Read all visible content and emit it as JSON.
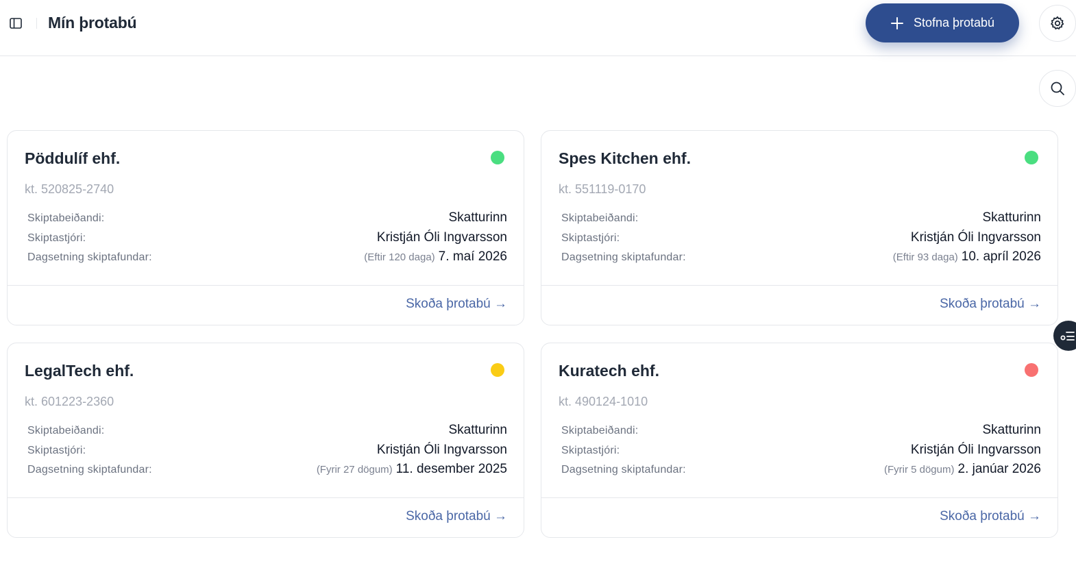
{
  "header": {
    "title": "Mín þrotabú",
    "create_label": "Stofna þrotabú"
  },
  "colors": {
    "accent": "#2e4d8f",
    "status_green": "#4ade80",
    "status_yellow": "#facc15",
    "status_red": "#f87171"
  },
  "icons": {
    "sidebar": "sidebar-toggle-icon",
    "create": "plus-icon",
    "settings": "gear-icon",
    "search": "search-icon",
    "side_panel": "list-settings-icon"
  },
  "labels": {
    "requester": "Skiptabeiðandi:",
    "administrator": "Skiptastjóri:",
    "meeting_date": "Dagsetning skiptafundar:",
    "view_link": "Skoða þrotabú →"
  },
  "estates": [
    {
      "name": "Pöddulíf ehf.",
      "kt": "kt. 520825-2740",
      "status": "green",
      "requester": "Skatturinn",
      "administrator": "Kristján Óli Ingvarsson",
      "relative": "(Eftir 120 daga)",
      "date": "7. maí 2026"
    },
    {
      "name": "Spes Kitchen ehf.",
      "kt": "kt. 551119-0170",
      "status": "green",
      "requester": "Skatturinn",
      "administrator": "Kristján Óli Ingvarsson",
      "relative": "(Eftir 93 daga)",
      "date": "10. apríl 2026"
    },
    {
      "name": "LegalTech ehf.",
      "kt": "kt. 601223-2360",
      "status": "yellow",
      "requester": "Skatturinn",
      "administrator": "Kristján Óli Ingvarsson",
      "relative": "(Fyrir 27 dögum)",
      "date": "11. desember 2025"
    },
    {
      "name": "Kuratech ehf.",
      "kt": "kt. 490124-1010",
      "status": "red",
      "requester": "Skatturinn",
      "administrator": "Kristján Óli Ingvarsson",
      "relative": "(Fyrir 5 dögum)",
      "date": "2. janúar 2026"
    }
  ]
}
